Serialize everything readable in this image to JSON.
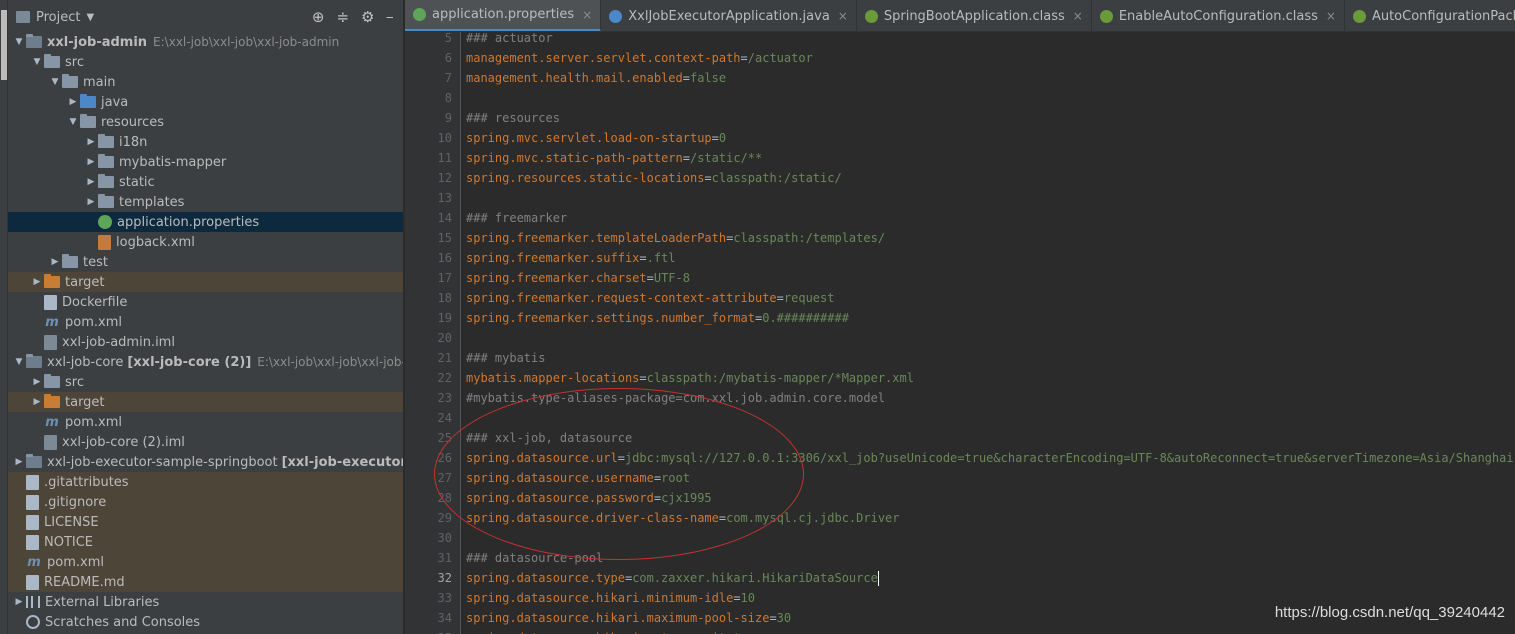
{
  "panel": {
    "title": "Project",
    "tools": [
      "target-icon",
      "collapse-icon",
      "gear-icon",
      "hide-icon"
    ]
  },
  "tree": [
    {
      "level": 0,
      "arrow": "▼",
      "icon": "folder module",
      "name": "xxl-job-admin",
      "bold": true,
      "path": "E:\\xxl-job\\xxl-job\\xxl-job-admin",
      "cls": ""
    },
    {
      "level": 1,
      "arrow": "▼",
      "icon": "folder",
      "name": "src",
      "cls": ""
    },
    {
      "level": 2,
      "arrow": "▼",
      "icon": "folder",
      "name": "main",
      "cls": ""
    },
    {
      "level": 3,
      "arrow": "▶",
      "icon": "folder src",
      "name": "java",
      "cls": ""
    },
    {
      "level": 3,
      "arrow": "▼",
      "icon": "folder res",
      "name": "resources",
      "cls": ""
    },
    {
      "level": 4,
      "arrow": "▶",
      "icon": "folder",
      "name": "i18n",
      "cls": ""
    },
    {
      "level": 4,
      "arrow": "▶",
      "icon": "folder",
      "name": "mybatis-mapper",
      "cls": ""
    },
    {
      "level": 4,
      "arrow": "▶",
      "icon": "folder",
      "name": "static",
      "cls": ""
    },
    {
      "level": 4,
      "arrow": "▶",
      "icon": "folder",
      "name": "templates",
      "cls": ""
    },
    {
      "level": 4,
      "arrow": "",
      "icon": "file props",
      "name": "application.properties",
      "cls": "sel"
    },
    {
      "level": 4,
      "arrow": "",
      "icon": "file xml",
      "name": "logback.xml",
      "cls": ""
    },
    {
      "level": 2,
      "arrow": "▶",
      "icon": "folder",
      "name": "test",
      "cls": ""
    },
    {
      "level": 1,
      "arrow": "▶",
      "icon": "folder target",
      "name": "target",
      "cls": "excluded"
    },
    {
      "level": 1,
      "arrow": "",
      "icon": "file",
      "name": "Dockerfile",
      "cls": ""
    },
    {
      "level": 1,
      "arrow": "",
      "icon": "maven",
      "name": "pom.xml",
      "cls": ""
    },
    {
      "level": 1,
      "arrow": "",
      "icon": "file iml",
      "name": "xxl-job-admin.iml",
      "cls": ""
    },
    {
      "level": 0,
      "arrow": "▼",
      "icon": "folder module",
      "name": "xxl-job-core",
      "tag": "[xxl-job-core (2)]",
      "path": "E:\\xxl-job\\xxl-job\\xxl-job-core",
      "cls": ""
    },
    {
      "level": 1,
      "arrow": "▶",
      "icon": "folder",
      "name": "src",
      "cls": ""
    },
    {
      "level": 1,
      "arrow": "▶",
      "icon": "folder target",
      "name": "target",
      "cls": "excluded"
    },
    {
      "level": 1,
      "arrow": "",
      "icon": "maven",
      "name": "pom.xml",
      "cls": ""
    },
    {
      "level": 1,
      "arrow": "",
      "icon": "file iml",
      "name": "xxl-job-core (2).iml",
      "cls": ""
    },
    {
      "level": 0,
      "arrow": "▶",
      "icon": "folder module",
      "name": "xxl-job-executor-sample-springboot",
      "tag": "[xxl-job-executor-samp",
      "cls": ""
    },
    {
      "level": 0,
      "arrow": "",
      "icon": "file",
      "name": ".gitattributes",
      "cls": "ignored"
    },
    {
      "level": 0,
      "arrow": "",
      "icon": "file",
      "name": ".gitignore",
      "cls": "ignored"
    },
    {
      "level": 0,
      "arrow": "",
      "icon": "file",
      "name": "LICENSE",
      "cls": "ignored"
    },
    {
      "level": 0,
      "arrow": "",
      "icon": "file",
      "name": "NOTICE",
      "cls": "ignored"
    },
    {
      "level": 0,
      "arrow": "",
      "icon": "maven",
      "name": "pom.xml",
      "cls": "ignored"
    },
    {
      "level": 0,
      "arrow": "",
      "icon": "file",
      "name": "README.md",
      "cls": "ignored"
    },
    {
      "level": 0,
      "arrow": "▶",
      "icon": "lib",
      "name": "External Libraries",
      "cls": ""
    },
    {
      "level": 0,
      "arrow": "",
      "icon": "scratch",
      "name": "Scratches and Consoles",
      "cls": ""
    }
  ],
  "tabs": [
    {
      "label": "application.properties",
      "icon": "props",
      "active": true,
      "close": true
    },
    {
      "label": "XxlJobExecutorApplication.java",
      "icon": "java",
      "active": false,
      "close": true
    },
    {
      "label": "SpringBootApplication.class",
      "icon": "cls",
      "active": false,
      "close": true
    },
    {
      "label": "EnableAutoConfiguration.class",
      "icon": "cls",
      "active": false,
      "close": true
    },
    {
      "label": "AutoConfigurationPackage.class",
      "icon": "cls",
      "active": false,
      "close": true
    },
    {
      "label": "",
      "icon": "cls",
      "active": false,
      "close": false
    }
  ],
  "code": {
    "first_line": 5,
    "current_line": 32,
    "lines": [
      {
        "type": "comment",
        "text": "### actuator"
      },
      {
        "type": "kv",
        "key": "management.server.servlet.context-path",
        "value": "/actuator"
      },
      {
        "type": "kv",
        "key": "management.health.mail.enabled",
        "value": "false"
      },
      {
        "type": "blank",
        "text": ""
      },
      {
        "type": "comment",
        "text": "### resources"
      },
      {
        "type": "kv",
        "key": "spring.mvc.servlet.load-on-startup",
        "value": "0"
      },
      {
        "type": "kv",
        "key": "spring.mvc.static-path-pattern",
        "value": "/static/**"
      },
      {
        "type": "kv",
        "key": "spring.resources.static-locations",
        "value": "classpath:/static/"
      },
      {
        "type": "blank",
        "text": ""
      },
      {
        "type": "comment",
        "text": "### freemarker"
      },
      {
        "type": "kv",
        "key": "spring.freemarker.templateLoaderPath",
        "value": "classpath:/templates/"
      },
      {
        "type": "kv",
        "key": "spring.freemarker.suffix",
        "value": ".ftl"
      },
      {
        "type": "kv",
        "key": "spring.freemarker.charset",
        "value": "UTF-8"
      },
      {
        "type": "kv",
        "key": "spring.freemarker.request-context-attribute",
        "value": "request"
      },
      {
        "type": "kv",
        "key": "spring.freemarker.settings.number_format",
        "value": "0.##########"
      },
      {
        "type": "blank",
        "text": ""
      },
      {
        "type": "comment",
        "text": "### mybatis"
      },
      {
        "type": "kv",
        "key": "mybatis.mapper-locations",
        "value": "classpath:/mybatis-mapper/*Mapper.xml"
      },
      {
        "type": "comment",
        "text": "#mybatis.type-aliases-package=com.xxl.job.admin.core.model"
      },
      {
        "type": "blank",
        "text": ""
      },
      {
        "type": "comment",
        "text": "### xxl-job, datasource"
      },
      {
        "type": "kv",
        "key": "spring.datasource.url",
        "value": "jdbc:mysql://127.0.0.1:3306/xxl_job?useUnicode=true&characterEncoding=UTF-8&autoReconnect=true&serverTimezone=Asia/Shanghai"
      },
      {
        "type": "kv",
        "key": "spring.datasource.username",
        "value": "root"
      },
      {
        "type": "kv",
        "key": "spring.datasource.password",
        "value": "cjx1995"
      },
      {
        "type": "kv",
        "key": "spring.datasource.driver-class-name",
        "value": "com.mysql.cj.jdbc.Driver"
      },
      {
        "type": "blank",
        "text": ""
      },
      {
        "type": "comment",
        "text": "### datasource-pool"
      },
      {
        "type": "kv",
        "key": "spring.datasource.type",
        "value": "com.zaxxer.hikari.HikariDataSource"
      },
      {
        "type": "kv",
        "key": "spring.datasource.hikari.minimum-idle",
        "value": "10"
      },
      {
        "type": "kv",
        "key": "spring.datasource.hikari.maximum-pool-size",
        "value": "30"
      },
      {
        "type": "kv",
        "key": "spring.datasource.hikari.auto-commit",
        "value": "true"
      }
    ]
  },
  "watermark": "https://blog.csdn.net/qq_39240442"
}
